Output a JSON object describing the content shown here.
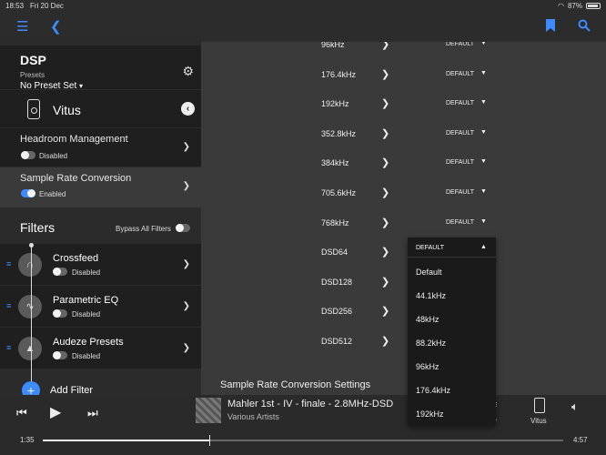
{
  "status": {
    "time": "18:53",
    "date": "Fri 20 Dec",
    "battery": "87%",
    "battery_level": 0.87
  },
  "nav": {
    "menu_icon": "menu-icon",
    "back_icon": "back-chevron-icon",
    "bookmark_icon": "bookmark-icon",
    "search_icon": "search-icon"
  },
  "sidebar": {
    "dsp_title": "DSP",
    "presets_label": "Presets",
    "preset_value": "No Preset Set",
    "device_name": "Vitus",
    "headroom": {
      "title": "Headroom Management",
      "state": "Disabled",
      "enabled": false
    },
    "src": {
      "title": "Sample Rate Conversion",
      "state": "Enabled",
      "enabled": true
    },
    "filters_title": "Filters",
    "bypass_label": "Bypass All Filters",
    "filters": [
      {
        "name": "Crossfeed",
        "state": "Disabled",
        "icon": "headphones-icon"
      },
      {
        "name": "Parametric EQ",
        "state": "Disabled",
        "icon": "eq-curve-icon"
      },
      {
        "name": "Audeze Presets",
        "state": "Disabled",
        "icon": "audeze-logo-icon"
      }
    ],
    "add_filter": "Add Filter"
  },
  "main": {
    "rates": [
      {
        "label": "96kHz",
        "value": "DEFAULT"
      },
      {
        "label": "176.4kHz",
        "value": "DEFAULT"
      },
      {
        "label": "192kHz",
        "value": "DEFAULT"
      },
      {
        "label": "352.8kHz",
        "value": "DEFAULT"
      },
      {
        "label": "384kHz",
        "value": "DEFAULT"
      },
      {
        "label": "705.6kHz",
        "value": "DEFAULT"
      },
      {
        "label": "768kHz",
        "value": "DEFAULT"
      },
      {
        "label": "DSD64",
        "value": ""
      },
      {
        "label": "DSD128",
        "value": ""
      },
      {
        "label": "DSD256",
        "value": ""
      },
      {
        "label": "DSD512",
        "value": ""
      }
    ],
    "settings_title": "Sample Rate Conversion Settings"
  },
  "dropdown": {
    "selected": "DEFAULT",
    "options": [
      "Default",
      "44.1kHz",
      "48kHz",
      "88.2kHz",
      "96kHz",
      "176.4kHz",
      "192kHz"
    ]
  },
  "player": {
    "track_title": "Mahler 1st - IV - finale - 2.8MHz-DSD",
    "artist": "Various Artists",
    "queue_label": "ue",
    "device_label": "Vitus",
    "elapsed": "1:35",
    "total": "4:57",
    "progress_fraction": 0.32
  }
}
